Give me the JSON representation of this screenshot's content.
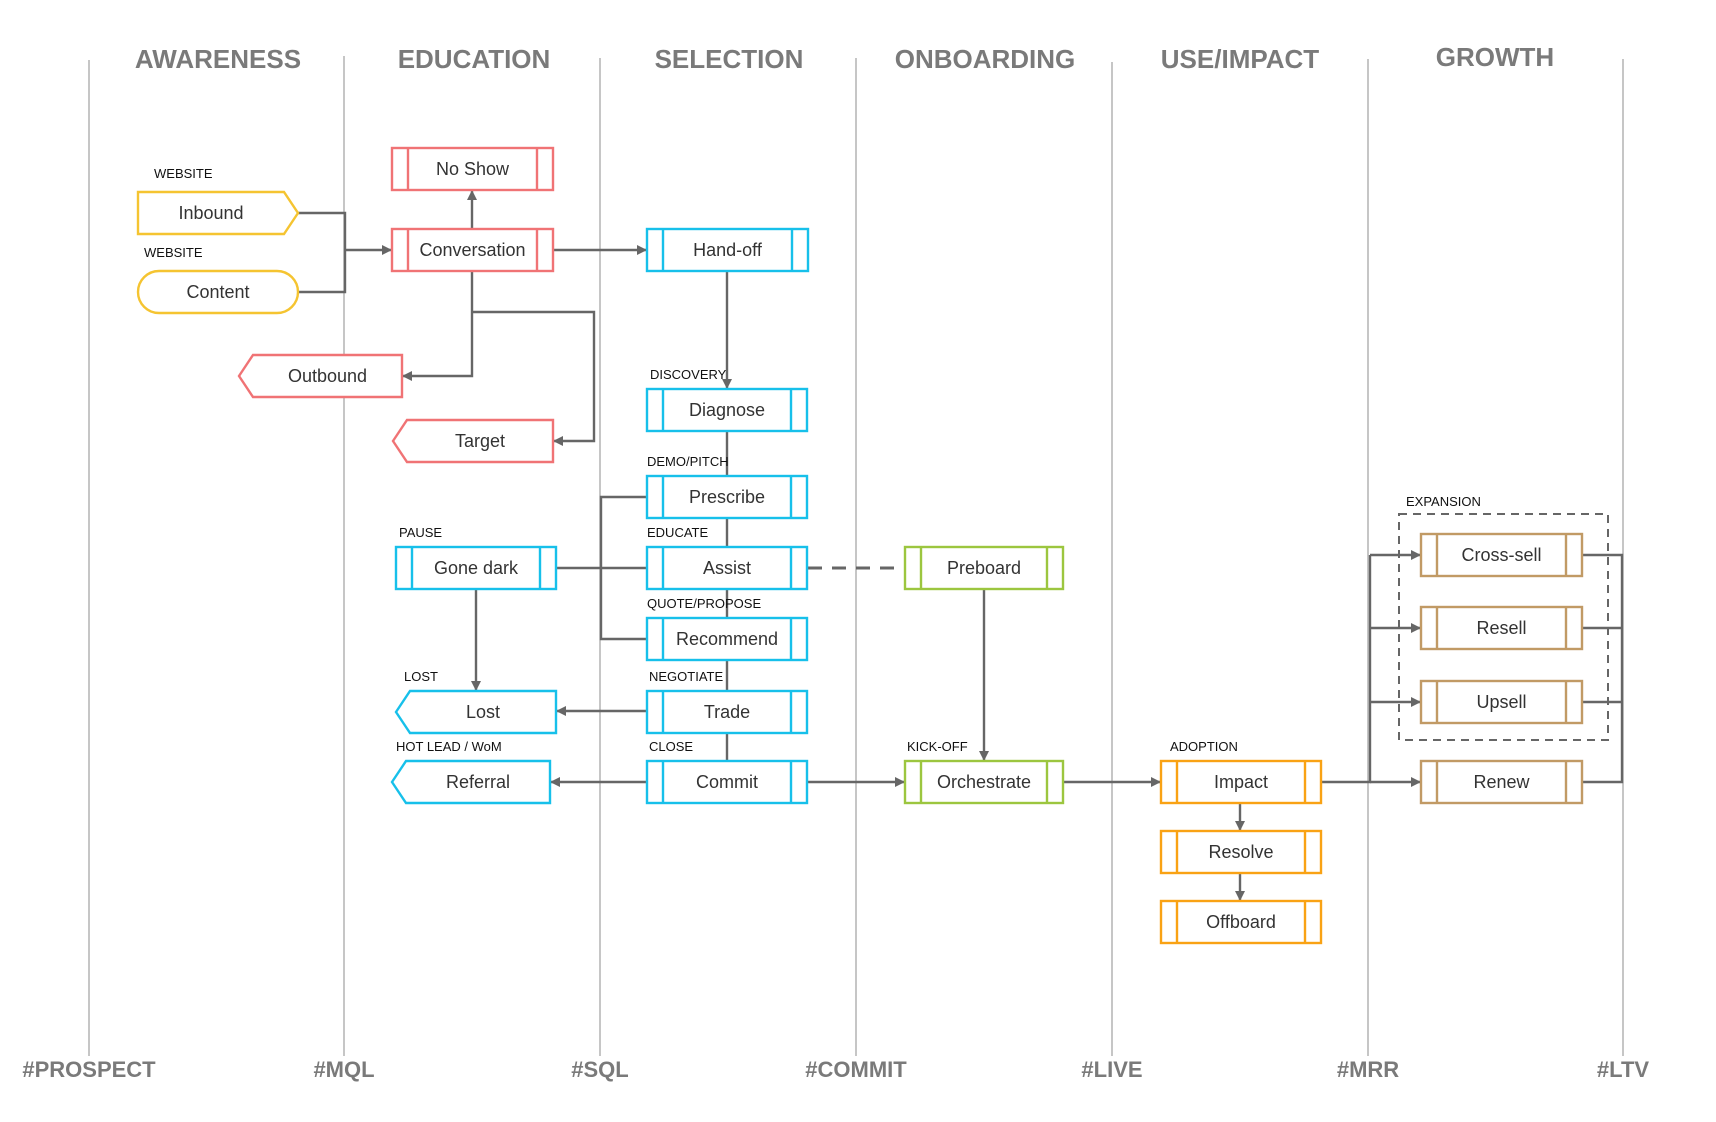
{
  "colors": {
    "awareness": "#f5c431",
    "education": "#f07375",
    "selection": "#17c0ea",
    "onboarding": "#9cc63f",
    "use_impact": "#f9a214",
    "growth": "#c19a65",
    "connector": "#666666",
    "header_text": "#7a7a7a"
  },
  "stages": [
    {
      "id": "awareness",
      "title": "AWARENESS"
    },
    {
      "id": "education",
      "title": "EDUCATION"
    },
    {
      "id": "selection",
      "title": "SELECTION"
    },
    {
      "id": "onboarding",
      "title": "ONBOARDING"
    },
    {
      "id": "use_impact",
      "title": "USE/IMPACT"
    },
    {
      "id": "growth",
      "title": "GROWTH"
    }
  ],
  "milestones": [
    "#PROSPECT",
    "#MQL",
    "#SQL",
    "#COMMIT",
    "#LIVE",
    "#MRR",
    "#LTV"
  ],
  "nodes": [
    {
      "id": "inbound",
      "label": "Inbound",
      "tag": "WEBSITE",
      "shape": "pentagon-right",
      "stage": "awareness"
    },
    {
      "id": "content",
      "label": "Content",
      "tag": "WEBSITE",
      "shape": "pill",
      "stage": "awareness"
    },
    {
      "id": "outbound",
      "label": "Outbound",
      "tag": "",
      "shape": "pentagon-left",
      "stage": "education"
    },
    {
      "id": "no_show",
      "label": "No Show",
      "tag": "",
      "shape": "process",
      "stage": "education"
    },
    {
      "id": "conversation",
      "label": "Conversation",
      "tag": "",
      "shape": "process",
      "stage": "education"
    },
    {
      "id": "target",
      "label": "Target",
      "tag": "",
      "shape": "pentagon-left",
      "stage": "education"
    },
    {
      "id": "hand_off",
      "label": "Hand-off",
      "tag": "",
      "shape": "process",
      "stage": "selection"
    },
    {
      "id": "diagnose",
      "label": "Diagnose",
      "tag": "DISCOVERY",
      "shape": "process",
      "stage": "selection"
    },
    {
      "id": "prescribe",
      "label": "Prescribe",
      "tag": "DEMO/PITCH",
      "shape": "process",
      "stage": "selection"
    },
    {
      "id": "assist",
      "label": "Assist",
      "tag": "EDUCATE",
      "shape": "process",
      "stage": "selection"
    },
    {
      "id": "recommend",
      "label": "Recommend",
      "tag": "QUOTE/PROPOSE",
      "shape": "process",
      "stage": "selection"
    },
    {
      "id": "trade",
      "label": "Trade",
      "tag": "NEGOTIATE",
      "shape": "process",
      "stage": "selection"
    },
    {
      "id": "commit",
      "label": "Commit",
      "tag": "CLOSE",
      "shape": "process",
      "stage": "selection"
    },
    {
      "id": "gone_dark",
      "label": "Gone dark",
      "tag": "PAUSE",
      "shape": "process",
      "stage": "selection"
    },
    {
      "id": "lost",
      "label": "Lost",
      "tag": "LOST",
      "shape": "pentagon-left",
      "stage": "selection"
    },
    {
      "id": "referral",
      "label": "Referral",
      "tag": "HOT LEAD / WoM",
      "shape": "pentagon-left",
      "stage": "selection"
    },
    {
      "id": "preboard",
      "label": "Preboard",
      "tag": "",
      "shape": "process",
      "stage": "onboarding"
    },
    {
      "id": "orchestrate",
      "label": "Orchestrate",
      "tag": "KICK-OFF",
      "shape": "process",
      "stage": "onboarding"
    },
    {
      "id": "impact",
      "label": "Impact",
      "tag": "ADOPTION",
      "shape": "process",
      "stage": "use_impact"
    },
    {
      "id": "resolve",
      "label": "Resolve",
      "tag": "",
      "shape": "process",
      "stage": "use_impact"
    },
    {
      "id": "offboard",
      "label": "Offboard",
      "tag": "",
      "shape": "process",
      "stage": "use_impact"
    },
    {
      "id": "cross_sell",
      "label": "Cross-sell",
      "tag": "",
      "shape": "process",
      "stage": "growth"
    },
    {
      "id": "resell",
      "label": "Resell",
      "tag": "",
      "shape": "process",
      "stage": "growth"
    },
    {
      "id": "upsell",
      "label": "Upsell",
      "tag": "",
      "shape": "process",
      "stage": "growth"
    },
    {
      "id": "renew",
      "label": "Renew",
      "tag": "",
      "shape": "process",
      "stage": "growth"
    }
  ],
  "groups": [
    {
      "id": "expansion",
      "label": "EXPANSION",
      "members": [
        "cross_sell",
        "resell",
        "upsell"
      ]
    }
  ],
  "edges": [
    {
      "from": "inbound",
      "to": "conversation",
      "arrow": true
    },
    {
      "from": "content",
      "to": "conversation",
      "arrow": true
    },
    {
      "from": "conversation",
      "to": "no_show",
      "arrow": true
    },
    {
      "from": "conversation",
      "to": "hand_off",
      "arrow": true
    },
    {
      "from": "conversation",
      "to": "outbound",
      "arrow": true
    },
    {
      "from": "conversation",
      "to": "target",
      "arrow": true
    },
    {
      "from": "hand_off",
      "to": "diagnose",
      "arrow": true
    },
    {
      "from": "diagnose",
      "to": "prescribe",
      "arrow": false
    },
    {
      "from": "prescribe",
      "to": "assist",
      "arrow": false
    },
    {
      "from": "assist",
      "to": "recommend",
      "arrow": false
    },
    {
      "from": "recommend",
      "to": "trade",
      "arrow": false
    },
    {
      "from": "trade",
      "to": "commit",
      "arrow": false
    },
    {
      "from": "gone_dark",
      "to": "prescribe",
      "arrow": false
    },
    {
      "from": "gone_dark",
      "to": "assist",
      "arrow": false
    },
    {
      "from": "gone_dark",
      "to": "recommend",
      "arrow": false
    },
    {
      "from": "gone_dark",
      "to": "lost",
      "arrow": true
    },
    {
      "from": "trade",
      "to": "lost",
      "arrow": true
    },
    {
      "from": "commit",
      "to": "referral",
      "arrow": true
    },
    {
      "from": "commit",
      "to": "orchestrate",
      "arrow": true
    },
    {
      "from": "assist",
      "to": "preboard",
      "arrow": false,
      "dashed": true
    },
    {
      "from": "preboard",
      "to": "orchestrate",
      "arrow": true
    },
    {
      "from": "orchestrate",
      "to": "impact",
      "arrow": true
    },
    {
      "from": "impact",
      "to": "resolve",
      "arrow": true
    },
    {
      "from": "resolve",
      "to": "offboard",
      "arrow": true
    },
    {
      "from": "impact",
      "to": "cross_sell",
      "arrow": true
    },
    {
      "from": "impact",
      "to": "resell",
      "arrow": true
    },
    {
      "from": "impact",
      "to": "upsell",
      "arrow": true
    },
    {
      "from": "impact",
      "to": "renew",
      "arrow": true
    }
  ]
}
